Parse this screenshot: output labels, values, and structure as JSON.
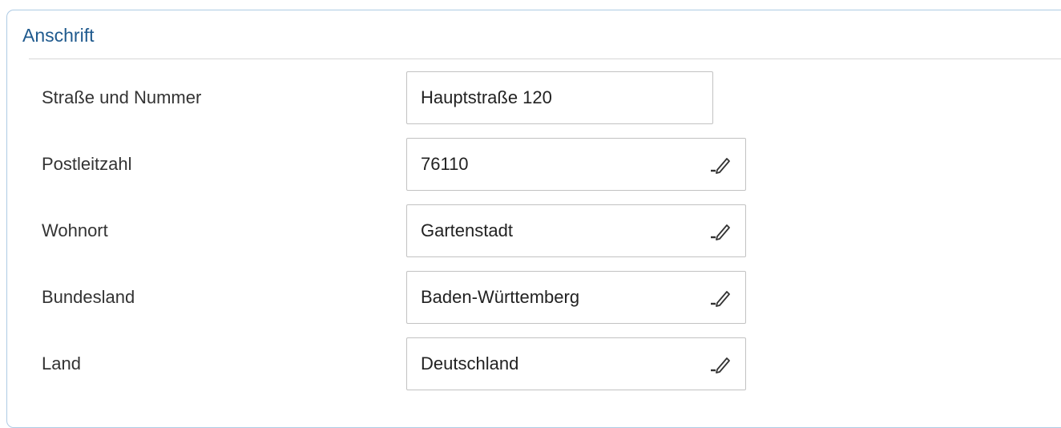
{
  "section": {
    "title": "Anschrift"
  },
  "fields": [
    {
      "label": "Straße und Nummer",
      "value": "Hauptstraße 120",
      "editable_icon": "none"
    },
    {
      "label": "Postleitzahl",
      "value": "76110",
      "editable_icon": "pencil-icon"
    },
    {
      "label": "Wohnort",
      "value": "Gartenstadt",
      "editable_icon": "pencil-icon"
    },
    {
      "label": "Bundesland",
      "value": "Baden-Württemberg",
      "editable_icon": "pencil-icon"
    },
    {
      "label": "Land",
      "value": "Deutschland",
      "editable_icon": "pencil-icon"
    }
  ],
  "colors": {
    "title": "#1f5a8e",
    "panel_border": "#aecbe4",
    "field_border": "#c2c2c2",
    "label_text": "#333333"
  }
}
